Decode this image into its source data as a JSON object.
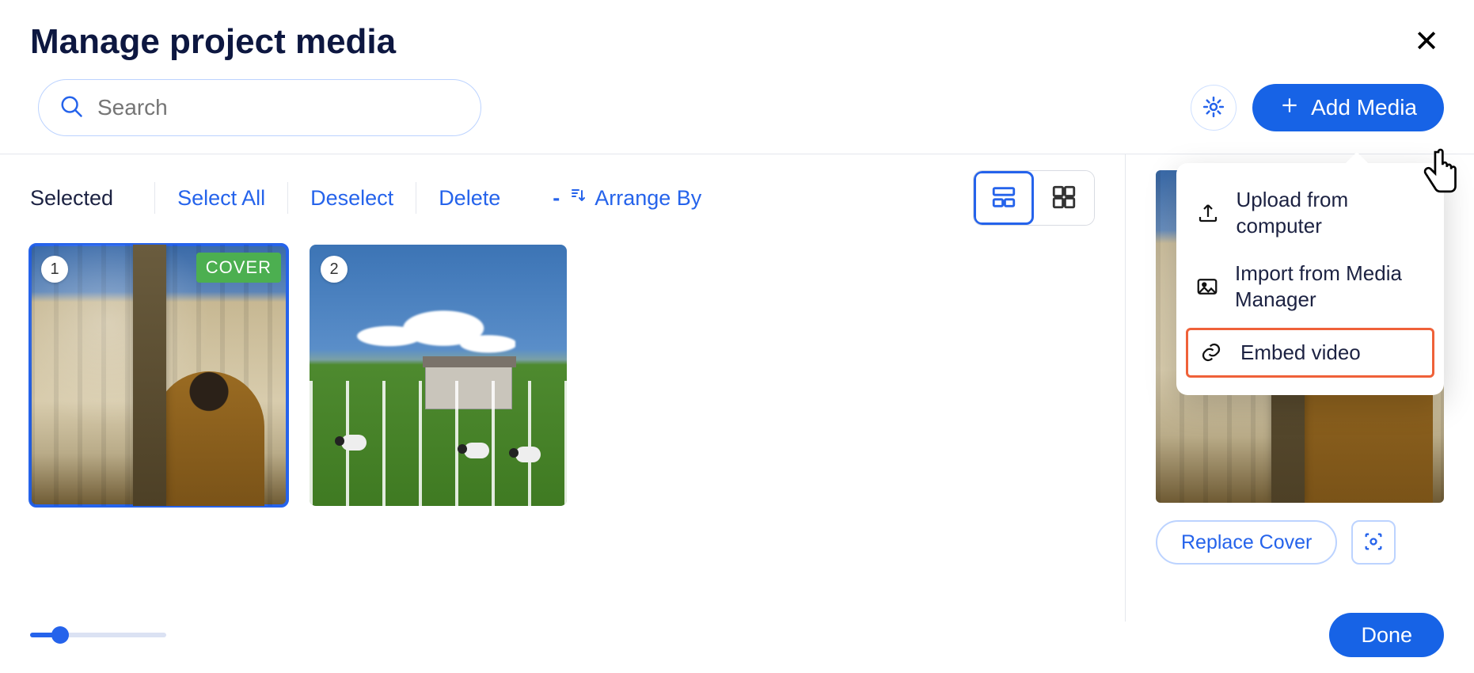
{
  "title": "Manage project media",
  "search": {
    "placeholder": "Search",
    "value": ""
  },
  "addMedia": {
    "label": "Add Media"
  },
  "selectionBar": {
    "selectedLabel": "Selected",
    "selectAll": "Select All",
    "deselect": "Deselect",
    "delete": "Delete",
    "arrangeBy": "Arrange By"
  },
  "viewMode": "row",
  "cards": [
    {
      "index": "1",
      "isCover": true,
      "coverLabel": "COVER",
      "selected": true
    },
    {
      "index": "2",
      "isCover": false,
      "selected": false
    }
  ],
  "preview": {
    "replaceCover": "Replace Cover"
  },
  "dropdown": {
    "items": [
      {
        "icon": "upload",
        "label": "Upload from computer",
        "highlight": false
      },
      {
        "icon": "image",
        "label": "Import from Media Manager",
        "highlight": false
      },
      {
        "icon": "link",
        "label": "Embed video",
        "highlight": true
      }
    ]
  },
  "slider": {
    "percent": 26
  },
  "done": "Done"
}
